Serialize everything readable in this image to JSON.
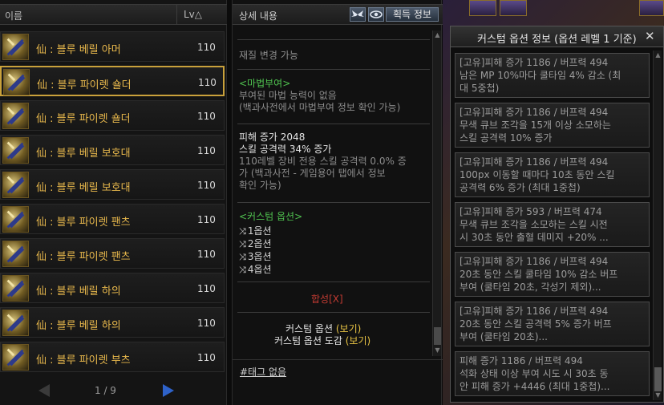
{
  "list": {
    "col_name": "이름",
    "col_lv": "Lv△",
    "items": [
      {
        "name": "仙 : 블루 베릴 아머",
        "lv": "110"
      },
      {
        "name": "仙 : 블루 파이렛 숄더",
        "lv": "110"
      },
      {
        "name": "仙 : 블루 파이렛 숄더",
        "lv": "110"
      },
      {
        "name": "仙 : 블루 베릴 보호대",
        "lv": "110"
      },
      {
        "name": "仙 : 블루 베릴 보호대",
        "lv": "110"
      },
      {
        "name": "仙 : 블루 파이렛 팬츠",
        "lv": "110"
      },
      {
        "name": "仙 : 블루 파이렛 팬츠",
        "lv": "110"
      },
      {
        "name": "仙 : 블루 베릴 하의",
        "lv": "110"
      },
      {
        "name": "仙 : 블루 베릴 하의",
        "lv": "110"
      },
      {
        "name": "仙 : 블루 파이렛 부츠",
        "lv": "110"
      }
    ],
    "selected_index": 1,
    "page": "1 / 9"
  },
  "detail": {
    "title": "상세 내용",
    "acquire_label": "획득 정보",
    "material_change": "재질 변경 가능",
    "magic_header": "<마법부여>",
    "magic_line1": "부여된 마법 능력이 없음",
    "magic_line2": "(백과사전에서 마법부여 정보 확인 가능)",
    "dmg_line": "피해 증가 2048",
    "skill_line": "스킬 공격력 34% 증가",
    "note_line1": "110레벨 장비 전용 스킬 공격력 0.0% 증",
    "note_line2": "가 (백과사전 - 게임용어 탭에서 정보",
    "note_line3": "확인 가능)",
    "custom_header": "<커스텀 옵션>",
    "options": [
      "1옵션",
      "2옵션",
      "3옵션",
      "4옵션"
    ],
    "fuse_label": "합성[X]",
    "custom_view_prefix": "커스텀 옵션 ",
    "custom_view_link": "(보기)",
    "custom_book_prefix": "커스텀 옵션 도감 ",
    "custom_book_link": "(보기)",
    "tag_text": "#태그 없음"
  },
  "popup": {
    "title": "커스텀 옵션 정보 (옵션 레벨 1 기준)",
    "close": "✕",
    "cards": [
      [
        "[고유]피해 증가 1186 / 버프력 494",
        "남은 MP 10%마다 쿨타임 4% 감소 (최",
        "대 5중첩)"
      ],
      [
        "[고유]피해 증가 1186 / 버프력 494",
        "무색 큐브 조각을 15개 이상 소모하는",
        "스킬 공격력 10% 증가"
      ],
      [
        "[고유]피해 증가 1186 / 버프력 494",
        "100px 이동할 때마다 10초 동안 스킬",
        "공격력 6% 증가 (최대 1중첩)"
      ],
      [
        "[고유]피해 증가 593 / 버프력 474",
        "무색 큐브 조각을 소모하는 스킬 시전",
        "시 30초 동안 출혈 데미지 +20% ..."
      ],
      [
        "[고유]피해 증가 1186 / 버프력 494",
        "20초 동안 스킬 쿨타임 10% 감소 버프",
        "부여 (쿨타임 20초, 각성기 제외)..."
      ],
      [
        "[고유]피해 증가 1186 / 버프력 494",
        "20초 동안 스킬 공격력 5% 증가 버프",
        "부여 (쿨타임 20초)..."
      ],
      [
        "피해 증가 1186 / 버프력 494",
        "석화 상태 이상 부여 시도 시 30초 동",
        "안 피해 증가 +4446 (최대 1중첩)..."
      ]
    ]
  }
}
